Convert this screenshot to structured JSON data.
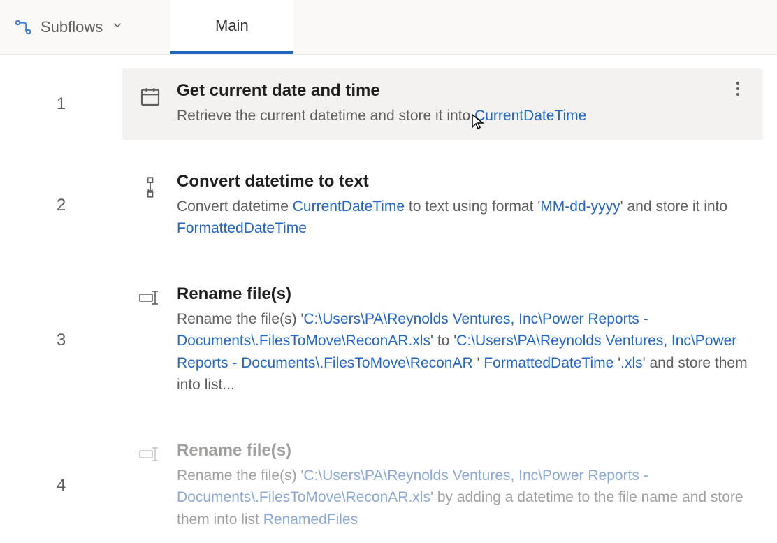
{
  "toolbar": {
    "subflows_label": "Subflows"
  },
  "tabs": [
    {
      "label": "Main",
      "active": true
    }
  ],
  "steps": [
    {
      "num": "1",
      "selected": true,
      "faded": false,
      "title": "Get current date and time",
      "desc_parts": [
        {
          "t": "text",
          "v": "Retrieve the current datetime and store it into "
        },
        {
          "t": "var",
          "v": "CurrentDateTime"
        }
      ],
      "icon": "calendar-clock"
    },
    {
      "num": "2",
      "selected": false,
      "faded": false,
      "title": "Convert datetime to text",
      "desc_parts": [
        {
          "t": "text",
          "v": "Convert datetime "
        },
        {
          "t": "var",
          "v": "CurrentDateTime"
        },
        {
          "t": "text",
          "v": " to text using format '"
        },
        {
          "t": "lit",
          "v": "MM-dd-yyyy"
        },
        {
          "t": "text",
          "v": "' and store it into "
        },
        {
          "t": "var",
          "v": "FormattedDateTime"
        }
      ],
      "icon": "text-convert"
    },
    {
      "num": "3",
      "selected": false,
      "faded": false,
      "title": "Rename file(s)",
      "desc_parts": [
        {
          "t": "text",
          "v": "Rename the file(s) '"
        },
        {
          "t": "lit",
          "v": "C:\\Users\\PA\\Reynolds Ventures, Inc\\Power Reports - Documents\\.FilesToMove\\ReconAR.xls"
        },
        {
          "t": "text",
          "v": "' to '"
        },
        {
          "t": "lit",
          "v": "C:\\Users\\PA\\Reynolds Ventures, Inc\\Power Reports - Documents\\.FilesToMove\\ReconAR "
        },
        {
          "t": "text",
          "v": "' "
        },
        {
          "t": "var",
          "v": "FormattedDateTime"
        },
        {
          "t": "text",
          "v": " '"
        },
        {
          "t": "lit",
          "v": ".xls"
        },
        {
          "t": "text",
          "v": "' and store them into list..."
        }
      ],
      "icon": "rename-file"
    },
    {
      "num": "4",
      "selected": false,
      "faded": true,
      "title": "Rename file(s)",
      "desc_parts": [
        {
          "t": "text",
          "v": "Rename the file(s) '"
        },
        {
          "t": "lit",
          "v": "C:\\Users\\PA\\Reynolds Ventures, Inc\\Power Reports - Documents\\.FilesToMove\\ReconAR.xls"
        },
        {
          "t": "text",
          "v": "' by adding a datetime to the file name and store them into list "
        },
        {
          "t": "var",
          "v": "RenamedFiles"
        }
      ],
      "icon": "rename-file"
    }
  ]
}
